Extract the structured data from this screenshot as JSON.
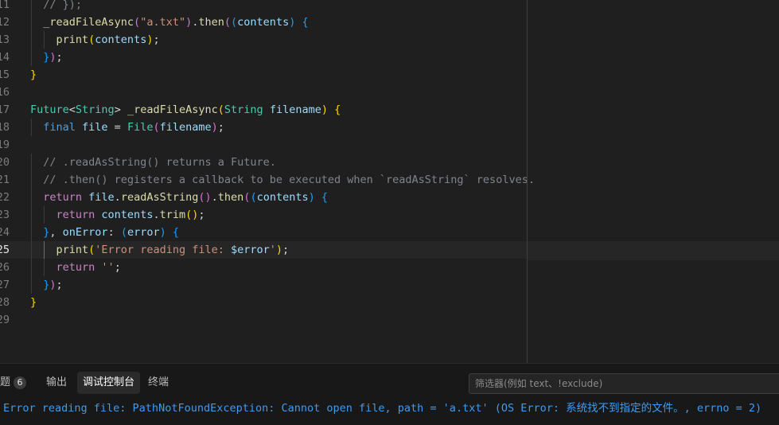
{
  "editor": {
    "lines": [
      {
        "n": "11",
        "indent": 1,
        "tokens": [
          [
            "// });",
            "t-comment"
          ]
        ]
      },
      {
        "n": "12",
        "indent": 1,
        "tokens": [
          [
            "_readFileAsync",
            "t-func"
          ],
          [
            "(",
            "t-b2"
          ],
          [
            "\"a.txt\"",
            "t-str"
          ],
          [
            ")",
            "t-b2"
          ],
          [
            ".",
            "t-punc"
          ],
          [
            "then",
            "t-func"
          ],
          [
            "(",
            "t-b2"
          ],
          [
            "(",
            "t-b3"
          ],
          [
            "contents",
            "t-var"
          ],
          [
            ")",
            "t-b3"
          ],
          [
            " ",
            "t-punc"
          ],
          [
            "{",
            "t-b3"
          ]
        ]
      },
      {
        "n": "13",
        "indent": 2,
        "tokens": [
          [
            "print",
            "t-func"
          ],
          [
            "(",
            "t-b1"
          ],
          [
            "contents",
            "t-var"
          ],
          [
            ")",
            "t-b1"
          ],
          [
            ";",
            "t-punc"
          ]
        ]
      },
      {
        "n": "14",
        "indent": 1,
        "tokens": [
          [
            "}",
            "t-b3"
          ],
          [
            ")",
            "t-b2"
          ],
          [
            ";",
            "t-punc"
          ]
        ]
      },
      {
        "n": "15",
        "indent": 0,
        "tokens": [
          [
            "}",
            "t-b1"
          ]
        ]
      },
      {
        "n": "16",
        "indent": 0,
        "tokens": []
      },
      {
        "n": "17",
        "indent": 0,
        "tokens": [
          [
            "Future",
            "t-type"
          ],
          [
            "<",
            "t-punc"
          ],
          [
            "String",
            "t-type"
          ],
          [
            "> ",
            "t-punc"
          ],
          [
            "_readFileAsync",
            "t-func"
          ],
          [
            "(",
            "t-b1"
          ],
          [
            "String ",
            "t-type"
          ],
          [
            "filename",
            "t-var"
          ],
          [
            ")",
            "t-b1"
          ],
          [
            " ",
            "t-punc"
          ],
          [
            "{",
            "t-b1"
          ]
        ]
      },
      {
        "n": "18",
        "indent": 1,
        "tokens": [
          [
            "final ",
            "t-kw2"
          ],
          [
            "file",
            "t-var"
          ],
          [
            " = ",
            "t-punc"
          ],
          [
            "File",
            "t-type"
          ],
          [
            "(",
            "t-b2"
          ],
          [
            "filename",
            "t-var"
          ],
          [
            ")",
            "t-b2"
          ],
          [
            ";",
            "t-punc"
          ]
        ]
      },
      {
        "n": "19",
        "indent": 0,
        "tokens": []
      },
      {
        "n": "20",
        "indent": 1,
        "tokens": [
          [
            "// .readAsString() returns a Future.",
            "t-comment"
          ]
        ]
      },
      {
        "n": "21",
        "indent": 1,
        "tokens": [
          [
            "// .then() registers a callback to be executed when `readAsString` resolves.",
            "t-comment"
          ]
        ]
      },
      {
        "n": "22",
        "indent": 1,
        "tokens": [
          [
            "return ",
            "t-kw"
          ],
          [
            "file",
            "t-var"
          ],
          [
            ".",
            "t-punc"
          ],
          [
            "readAsString",
            "t-func"
          ],
          [
            "(",
            "t-b2"
          ],
          [
            ")",
            "t-b2"
          ],
          [
            ".",
            "t-punc"
          ],
          [
            "then",
            "t-func"
          ],
          [
            "(",
            "t-b2"
          ],
          [
            "(",
            "t-b3"
          ],
          [
            "contents",
            "t-var"
          ],
          [
            ")",
            "t-b3"
          ],
          [
            " ",
            "t-punc"
          ],
          [
            "{",
            "t-b3"
          ]
        ]
      },
      {
        "n": "23",
        "indent": 2,
        "tokens": [
          [
            "return ",
            "t-kw"
          ],
          [
            "contents",
            "t-var"
          ],
          [
            ".",
            "t-punc"
          ],
          [
            "trim",
            "t-func"
          ],
          [
            "(",
            "t-b1"
          ],
          [
            ")",
            "t-b1"
          ],
          [
            ";",
            "t-punc"
          ]
        ]
      },
      {
        "n": "24",
        "indent": 1,
        "tokens": [
          [
            "}",
            "t-b3"
          ],
          [
            ", ",
            "t-punc"
          ],
          [
            "onError",
            "t-var"
          ],
          [
            ": ",
            "t-punc"
          ],
          [
            "(",
            "t-b3"
          ],
          [
            "error",
            "t-var"
          ],
          [
            ")",
            "t-b3"
          ],
          [
            " ",
            "t-punc"
          ],
          [
            "{",
            "t-b3"
          ]
        ]
      },
      {
        "n": "25",
        "indent": 2,
        "current": true,
        "tokens": [
          [
            "print",
            "t-func"
          ],
          [
            "(",
            "t-b1"
          ],
          [
            "'Error reading file: ",
            "t-str"
          ],
          [
            "$error",
            "t-var"
          ],
          [
            "'",
            "t-str"
          ],
          [
            ")",
            "t-b1"
          ],
          [
            ";",
            "t-punc"
          ]
        ]
      },
      {
        "n": "26",
        "indent": 2,
        "tokens": [
          [
            "return ",
            "t-kw"
          ],
          [
            "''",
            "t-str"
          ],
          [
            ";",
            "t-punc"
          ]
        ]
      },
      {
        "n": "27",
        "indent": 1,
        "tokens": [
          [
            "}",
            "t-b3"
          ],
          [
            ")",
            "t-b2"
          ],
          [
            ";",
            "t-punc"
          ]
        ]
      },
      {
        "n": "28",
        "indent": 0,
        "tokens": [
          [
            "}",
            "t-b1"
          ]
        ]
      },
      {
        "n": "29",
        "indent": 0,
        "tokens": []
      }
    ]
  },
  "panel": {
    "tabs": [
      {
        "id": "problems",
        "label": "题",
        "badge": "6",
        "active": false
      },
      {
        "id": "output",
        "label": "输出",
        "active": false
      },
      {
        "id": "debug-console",
        "label": "调试控制台",
        "active": true
      },
      {
        "id": "terminal",
        "label": "终端",
        "active": false
      }
    ],
    "filter_placeholder": "筛选器(例如 text、!exclude)",
    "debug_output": "Error reading file: PathNotFoundException: Cannot open file, path = 'a.txt' (OS Error: 系统找不到指定的文件。, errno = 2)"
  }
}
